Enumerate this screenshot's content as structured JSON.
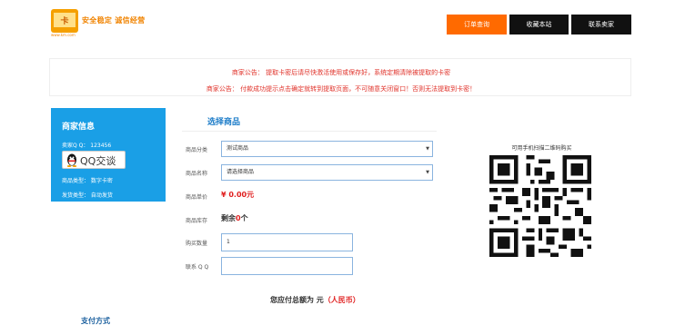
{
  "header": {
    "logo_text": "安全稳定 诚信经营",
    "logo_sub": "www.km.com",
    "nav": {
      "orders": "订单查询",
      "favorite": "收藏本站",
      "contact": "联系卖家"
    },
    "colors": {
      "accent": "#ff6a00",
      "nav_dark": "#111111",
      "brand": "#f08300"
    }
  },
  "notices": [
    "商家公告： 提取卡密后请尽快激活使用或保存好，系统定期清除被提取的卡密",
    "商家公告： 付款成功提示点击确定就转到提取页面，不可随意关闭窗口！否则无法提取到卡密！"
  ],
  "merchant": {
    "title": "商家信息",
    "qq": "卖家Q Q： 123456",
    "qq_button": "QQ交谈",
    "goods_type": "商品类型： 数字卡密",
    "ship_type": "发货类型： 自动发货"
  },
  "form": {
    "section_title": "选择商品",
    "category_label": "商品分类",
    "category_value": "测试商品",
    "name_label": "商品名称",
    "name_value": "请选择商品",
    "price_label": "商品单价",
    "price_value": "¥ 0.00元",
    "stock_label": "商品库存",
    "stock_prefix": "剩余",
    "stock_num": "0",
    "stock_suffix": "个",
    "qty_label": "购买数量",
    "qty_value": "1",
    "qq_label": "联系 Q Q",
    "qq_value": ""
  },
  "qr": {
    "caption": "可用手机扫描二维码购买"
  },
  "total": {
    "prefix": "您应付总额为 元",
    "unit": "（人民币）"
  },
  "payment": {
    "title": "支付方式"
  }
}
